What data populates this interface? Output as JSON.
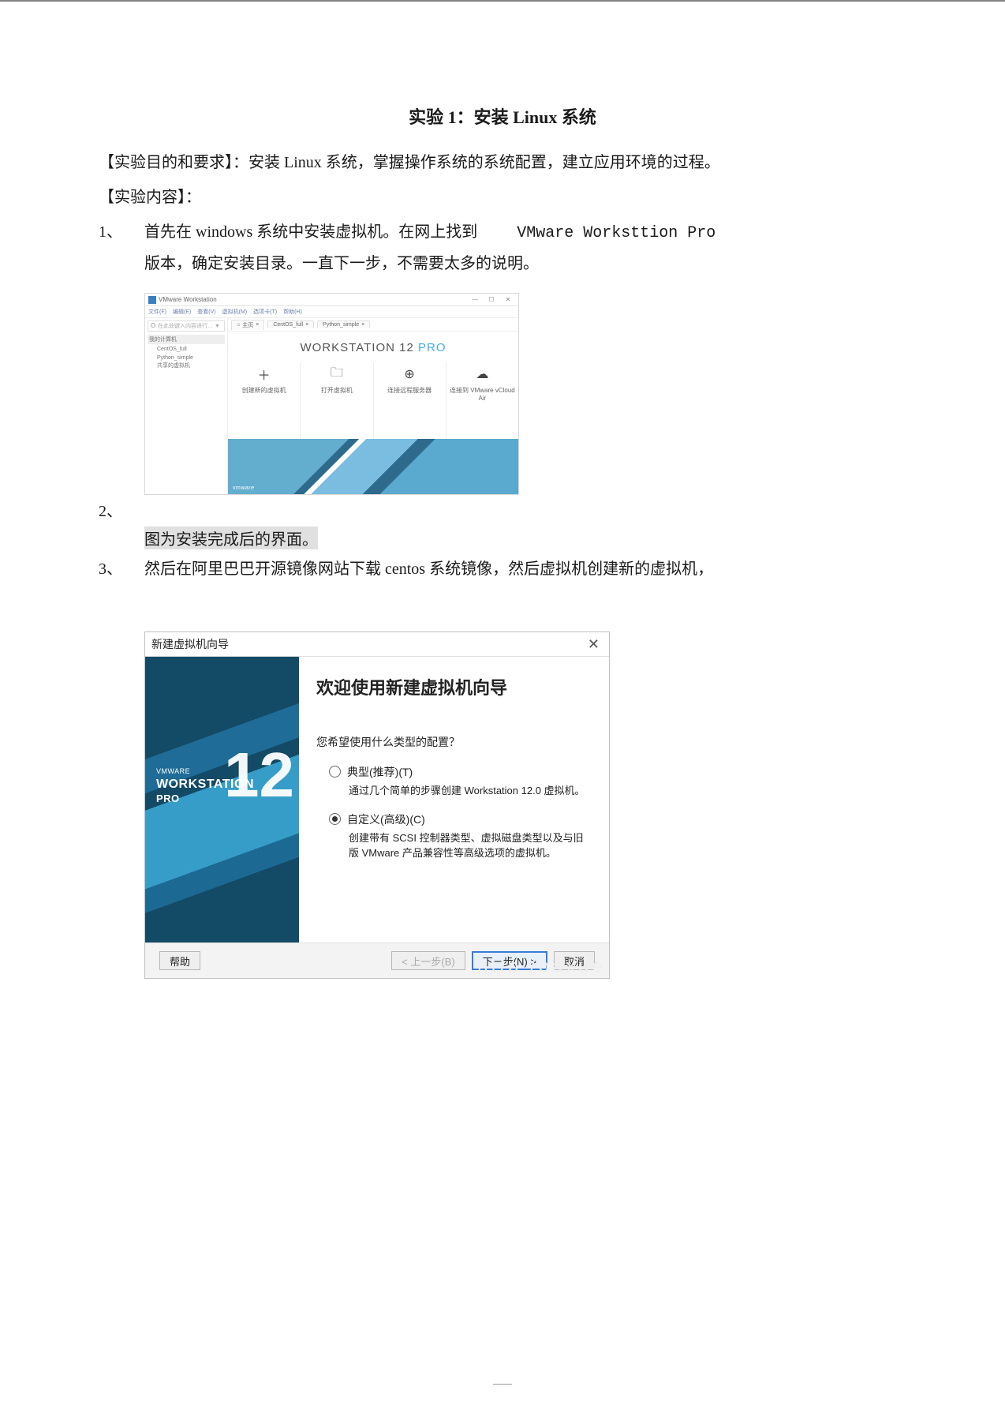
{
  "doc": {
    "title": "实验 1：安装 Linux 系统",
    "line_goal": "【实验目的和要求】：安装 Linux 系统，掌握操作系统的系统配置，建立应用环境的过程。",
    "line_content_hdr": "【实验内容】：",
    "item1_num": "1、",
    "item1_text_a": "首先在 windows 系统中安装虚拟机。在网上找到",
    "item1_text_b": "VMware Worksttion Pro",
    "item1_text_c": "版本，确定安装目录。一直下一步，不需要太多的说明。",
    "item2_num": "2、",
    "caption1": "图为安装完成后的界面。",
    "item3_num": "3、",
    "item3_text": "然后在阿里巴巴开源镜像网站下载 centos 系统镜像，然后虚拟机创建新的虚拟机，"
  },
  "vmware": {
    "title": "VMware Workstation",
    "menus": [
      "文件(F)",
      "编辑(E)",
      "查看(V)",
      "虚拟机(M)",
      "选项卡(T)",
      "帮助(H)"
    ],
    "tab_home": "主页",
    "tab_centos": "CentOS_full",
    "tab_python": "Python_simple",
    "search_placeholder": "在此处键入内容进行… ▼",
    "tree_header": "我的计算机",
    "tree_items": [
      "CentOS_full",
      "Python_simple",
      "共享的虚拟机"
    ],
    "brand_main": "WORKSTATION",
    "brand_ver": "12",
    "brand_pro": "PRO",
    "actions": [
      {
        "icon": "plus-icon",
        "glyph": "＋",
        "label": "创建新的虚拟机"
      },
      {
        "icon": "open-icon",
        "glyph": "🗀",
        "label": "打开虚拟机"
      },
      {
        "icon": "remote-server-icon",
        "glyph": "⊕",
        "label": "连接远程服务器"
      },
      {
        "icon": "cloud-icon",
        "glyph": "☁",
        "label": "连接到 VMware vCloud Air"
      }
    ],
    "brand_small": "vmware",
    "win_min": "—",
    "win_max": "☐",
    "win_close": "✕"
  },
  "wizard": {
    "title": "新建虚拟机向导",
    "close": "✕",
    "side_small": "VMWARE",
    "side_workstation": "WORKSTATION",
    "side_pro": "PRO",
    "side_12": "12",
    "heading": "欢迎使用新建虚拟机向导",
    "question": "您希望使用什么类型的配置？",
    "opt1_title": "典型(推荐)(T)",
    "opt1_desc": "通过几个简单的步骤创建 Workstation 12.0 虚拟机。",
    "opt2_title": "自定义(高级)(C)",
    "opt2_desc": "创建带有 SCSI 控制器类型、虚拟磁盘类型以及与旧版 VMware 产品兼容性等高级选项的虚拟机。",
    "btn_help": "帮助",
    "btn_back": "< 上一步(B)",
    "btn_next": "下一步(N) >",
    "btn_cancel": "取消",
    "watermark": "http   /baxue"
  }
}
